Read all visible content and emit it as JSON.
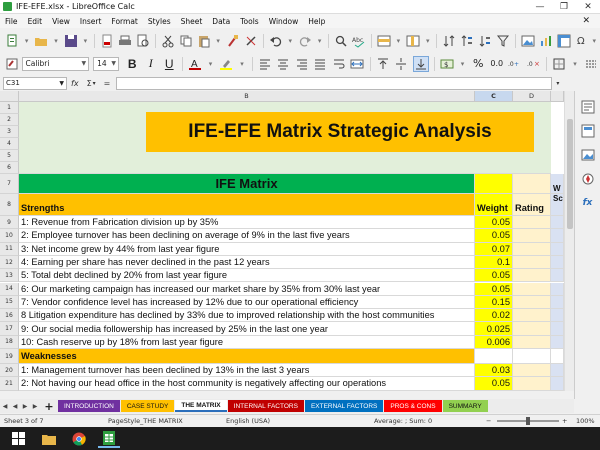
{
  "window": {
    "title": "IFE-EFE.xlsx - LibreOffice Calc",
    "min_glyph": "—",
    "max_glyph": "❐",
    "close_glyph": "✕"
  },
  "menu": [
    "File",
    "Edit",
    "View",
    "Insert",
    "Format",
    "Styles",
    "Sheet",
    "Data",
    "Tools",
    "Window",
    "Help"
  ],
  "toolbar": {
    "font_name": "Calibri",
    "font_size": "14",
    "bold": "B",
    "italic": "I",
    "underline": "U",
    "currency": "$",
    "percent": "%",
    "decimal": "0.0"
  },
  "formula_bar": {
    "cell_ref": "C31",
    "func_glyph": "fx",
    "sum_glyph": "Σ",
    "eq_glyph": "="
  },
  "columns": [
    {
      "label": "",
      "w": 19
    },
    {
      "label": "B",
      "w": 456
    },
    {
      "label": "C",
      "w": 38
    },
    {
      "label": "D",
      "w": 38
    },
    {
      "label": "",
      "w": 13
    }
  ],
  "sheet": {
    "title": "IFE-EFE Matrix Strategic Analysis",
    "ife_header": "IFE Matrix",
    "strengths_label": "Strengths",
    "weight_header": "Weight",
    "rating_header": "Rating",
    "weighted_score_partial": [
      "W",
      "Sc"
    ],
    "strengths": [
      {
        "row": "9",
        "text": "1: Revenue from Fabrication division up by 35%",
        "weight": "0.05"
      },
      {
        "row": "10",
        "text": "2: Employee turnover has been declining on average of 9% in the last five years",
        "weight": "0.05"
      },
      {
        "row": "11",
        "text": "3: Net income grew by 44% from last year figure",
        "weight": "0.07"
      },
      {
        "row": "12",
        "text": "4: Earning per share has never declined in the past 12 years",
        "weight": "0.1"
      },
      {
        "row": "13",
        "text": "5: Total debt declined  by 20% from last year figure",
        "weight": "0.05"
      },
      {
        "row": "14",
        "text": "6: Our marketing campaign has increased our market share by 35% from 30% last year",
        "weight": "0.05"
      },
      {
        "row": "15",
        "text": "7: Vendor confidence level has increased by 12% due to our operational efficiency",
        "weight": "0.15"
      },
      {
        "row": "16",
        "text": "8 Litigation expenditure has declined by 33% due to improved relationship with the host communities",
        "weight": "0.02"
      },
      {
        "row": "17",
        "text": "9: Our social media followership has increased by 25% in the last one year",
        "weight": "0.025"
      },
      {
        "row": "18",
        "text": "10: Cash reserve up by 18% from last year figure",
        "weight": "0.006"
      }
    ],
    "weaknesses_label": "Weaknesses",
    "weaknesses_row": "19",
    "weaknesses": [
      {
        "row": "20",
        "text": "1: Management turnover has been declined by 13%  in the last 3 years",
        "weight": "0.03"
      },
      {
        "row": "21",
        "text": "2: Not having our head office in the host community is negatively affecting our operations",
        "weight": "0.05"
      }
    ],
    "top_rows": [
      "1",
      "2",
      "3",
      "4",
      "5",
      "6"
    ],
    "row7": "7",
    "row8": "8"
  },
  "tabs": [
    {
      "label": "INTRODUCTION",
      "bg": "#7030a0",
      "fg": "#ffffff"
    },
    {
      "label": "CASE STUDY",
      "bg": "#ffc000",
      "fg": "#111111"
    },
    {
      "label": "THE MATRIX",
      "bg": "#ffffff",
      "fg": "#111111"
    },
    {
      "label": "INTERNAL FACTORS",
      "bg": "#c00000",
      "fg": "#ffffff"
    },
    {
      "label": "EXTERNAL FACTORS",
      "bg": "#0070c0",
      "fg": "#ffffff"
    },
    {
      "label": "PROS & CONS",
      "bg": "#ff0000",
      "fg": "#ffffff"
    },
    {
      "label": "SUMMARY",
      "bg": "#92d050",
      "fg": "#111111"
    }
  ],
  "status": {
    "sheet": "Sheet 3 of 7",
    "page_style": "PageStyle_THE MATRIX",
    "language": "English (USA)",
    "summary": "Average: ; Sum: 0",
    "zoom": "100%"
  },
  "colors": {
    "title_bg": "#ffc000",
    "band_bg": "#e2efda",
    "ife_bg": "#00b050",
    "strength_bg": "#ffc000",
    "weight_bg": "#ffff00",
    "rating_bg": "#fff2cc",
    "score_bg": "#d9e1f2"
  }
}
